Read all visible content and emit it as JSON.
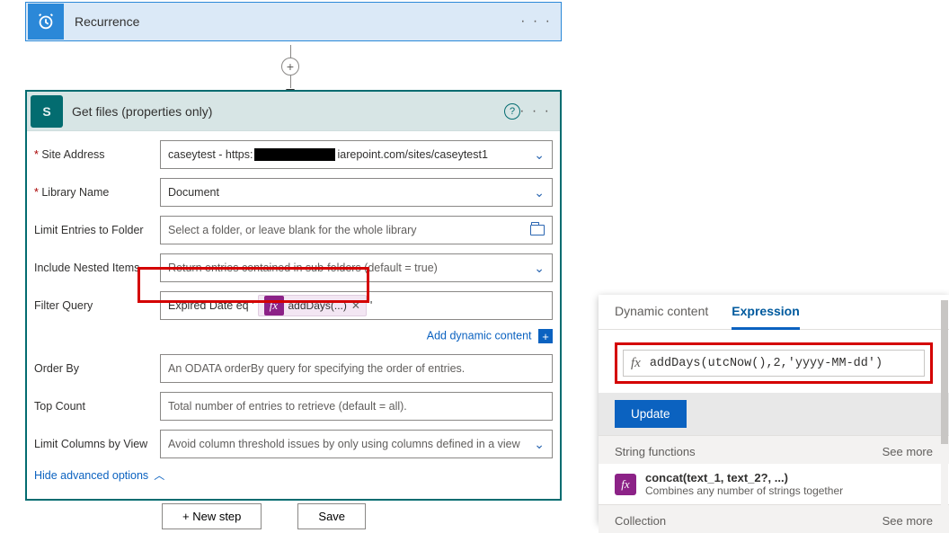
{
  "recurrence": {
    "title": "Recurrence"
  },
  "getfiles": {
    "title": "Get files (properties only)",
    "labels": {
      "site": "Site Address",
      "library": "Library Name",
      "folder": "Limit Entries to Folder",
      "nested": "Include Nested Items",
      "filter": "Filter Query",
      "orderby": "Order By",
      "topcount": "Top Count",
      "limitcols": "Limit Columns by View"
    },
    "values": {
      "site_prefix": "caseytest - https:",
      "site_suffix": "iarepoint.com/sites/caseytest1",
      "library": "Document",
      "folder_placeholder": "Select a folder, or leave blank for the whole library",
      "nested_placeholder": "Return entries contained in sub-folders (default = true)",
      "filter_text": "Expired Date eq '",
      "filter_token": "addDays(...)",
      "orderby_placeholder": "An ODATA orderBy query for specifying the order of entries.",
      "topcount_placeholder": "Total number of entries to retrieve (default = all).",
      "limitcols_placeholder": "Avoid column threshold issues by only using columns defined in a view"
    },
    "add_dynamic": "Add dynamic content",
    "hide_advanced": "Hide advanced options"
  },
  "buttons": {
    "new_step": "+ New step",
    "save": "Save"
  },
  "expr": {
    "tabs": {
      "dynamic": "Dynamic content",
      "expression": "Expression"
    },
    "expression_value": "addDays(utcNow(),2,'yyyy-MM-dd')",
    "update": "Update",
    "groups": {
      "string": "String functions",
      "collection": "Collection",
      "see_more": "See more"
    },
    "fn": {
      "concat_name": "concat(text_1, text_2?, ...)",
      "concat_desc": "Combines any number of strings together"
    }
  }
}
